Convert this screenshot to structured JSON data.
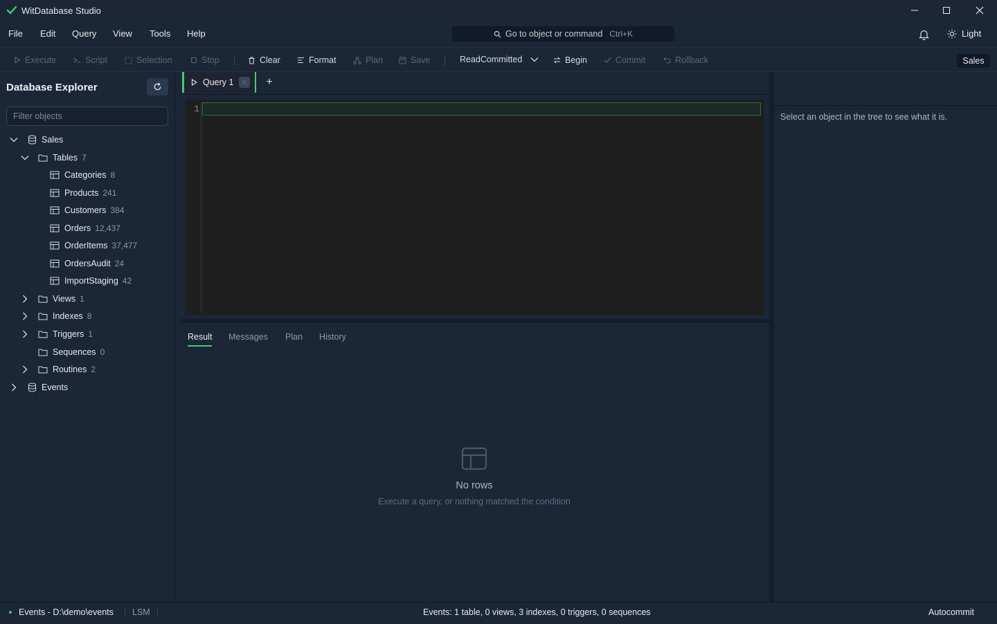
{
  "titlebar": {
    "title": "WitDatabase Studio"
  },
  "menu": {
    "items": [
      "File",
      "Edit",
      "Query",
      "View",
      "Tools",
      "Help"
    ]
  },
  "command_search": {
    "placeholder": "Go to object or command",
    "shortcut": "Ctrl+K"
  },
  "theme_toggle": {
    "label": "Light"
  },
  "toolbar": {
    "execute": "Execute",
    "script": "Script",
    "selection": "Selection",
    "stop": "Stop",
    "clear": "Clear",
    "format": "Format",
    "plan": "Plan",
    "save": "Save",
    "isolation": "ReadCommitted",
    "begin": "Begin",
    "commit": "Commit",
    "rollback": "Rollback",
    "database": "Sales"
  },
  "explorer": {
    "title": "Database Explorer",
    "filter_placeholder": "Filter objects",
    "tree": {
      "db1": "Sales",
      "tables": {
        "label": "Tables",
        "count": "7"
      },
      "table_items": [
        {
          "name": "Categories",
          "count": "8"
        },
        {
          "name": "Products",
          "count": "241"
        },
        {
          "name": "Customers",
          "count": "384"
        },
        {
          "name": "Orders",
          "count": "12,437"
        },
        {
          "name": "OrderItems",
          "count": "37,477"
        },
        {
          "name": "OrdersAudit",
          "count": "24"
        },
        {
          "name": "ImportStaging",
          "count": "42"
        }
      ],
      "views": {
        "label": "Views",
        "count": "1"
      },
      "indexes": {
        "label": "Indexes",
        "count": "8"
      },
      "triggers": {
        "label": "Triggers",
        "count": "1"
      },
      "sequences": {
        "label": "Sequences",
        "count": "0"
      },
      "routines": {
        "label": "Routines",
        "count": "2"
      },
      "db2": "Events"
    }
  },
  "editor": {
    "tab_label": "Query 1",
    "line_number": "1"
  },
  "results": {
    "tabs": [
      "Result",
      "Messages",
      "Plan",
      "History"
    ],
    "empty_title": "No rows",
    "empty_subtitle": "Execute a query, or nothing matched the condition"
  },
  "properties": {
    "hint": "Select an object in the tree to see what it is."
  },
  "status": {
    "connection": "Events - D:\\demo\\events",
    "engine": "LSM",
    "summary": "Events: 1 table, 0 views, 3 indexes, 0 triggers, 0 sequences",
    "mode": "Autocommit"
  },
  "colors": {
    "accent": "#3ecf6e",
    "background": "#1b2637",
    "editor_bg": "#1f1f1f"
  }
}
